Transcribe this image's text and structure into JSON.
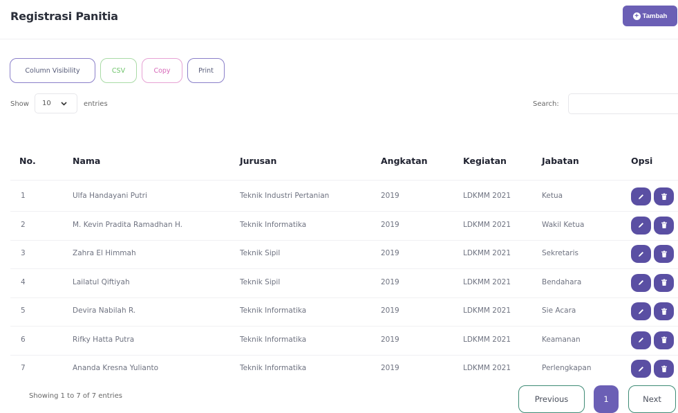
{
  "header": {
    "title": "Registrasi Panitia",
    "add_label": "Tambah"
  },
  "toolbar": {
    "column_visibility": "Column Visibility",
    "csv": "CSV",
    "copy": "Copy",
    "print": "Print"
  },
  "length": {
    "show": "Show",
    "value": "10",
    "entries": "entries"
  },
  "search": {
    "label": "Search:",
    "value": ""
  },
  "table": {
    "columns": [
      "No.",
      "Nama",
      "Jurusan",
      "Angkatan",
      "Kegiatan",
      "Jabatan",
      "Opsi"
    ],
    "rows": [
      {
        "no": "1",
        "nama": "Ulfa Handayani Putri",
        "jurusan": "Teknik Industri Pertanian",
        "angkatan": "2019",
        "kegiatan": "LDKMM 2021",
        "jabatan": "Ketua"
      },
      {
        "no": "2",
        "nama": "M. Kevin Pradita Ramadhan H.",
        "jurusan": "Teknik Informatika",
        "angkatan": "2019",
        "kegiatan": "LDKMM 2021",
        "jabatan": "Wakil Ketua"
      },
      {
        "no": "3",
        "nama": "Zahra El Himmah",
        "jurusan": "Teknik Sipil",
        "angkatan": "2019",
        "kegiatan": "LDKMM 2021",
        "jabatan": "Sekretaris"
      },
      {
        "no": "4",
        "nama": "Lailatul Qiftiyah",
        "jurusan": "Teknik Sipil",
        "angkatan": "2019",
        "kegiatan": "LDKMM 2021",
        "jabatan": "Bendahara"
      },
      {
        "no": "5",
        "nama": "Devira Nabilah R.",
        "jurusan": "Teknik Informatika",
        "angkatan": "2019",
        "kegiatan": "LDKMM 2021",
        "jabatan": "Sie Acara"
      },
      {
        "no": "6",
        "nama": "Rifky Hatta Putra",
        "jurusan": "Teknik Informatika",
        "angkatan": "2019",
        "kegiatan": "LDKMM 2021",
        "jabatan": "Keamanan"
      },
      {
        "no": "7",
        "nama": "Ananda Kresna Yulianto",
        "jurusan": "Teknik Informatika",
        "angkatan": "2019",
        "kegiatan": "LDKMM 2021",
        "jabatan": "Perlengkapan"
      }
    ]
  },
  "footer": {
    "info": "Showing 1 to 7 of 7 entries",
    "previous": "Previous",
    "page": "1",
    "next": "Next"
  },
  "colors": {
    "primary": "#6b5fb5",
    "action": "#5a4fa3",
    "csv": "#6ec36a",
    "copy": "#d667b8",
    "pager_border": "#3d8a74"
  }
}
